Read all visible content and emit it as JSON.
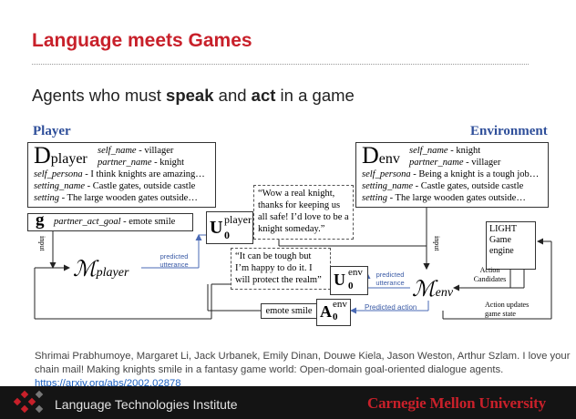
{
  "slide": {
    "title": "Language meets Games",
    "subtitle_pre": "Agents who must ",
    "subtitle_b1": "speak",
    "subtitle_mid": " and ",
    "subtitle_b2": "act",
    "subtitle_post": " in a game"
  },
  "diagram": {
    "player_header": "Player",
    "env_header": "Environment",
    "player_box": {
      "D": "D",
      "D_sub": "player",
      "l1_key": "self_name",
      "l1_val": " - villager",
      "l2_key": "partner_name",
      "l2_val": " - knight",
      "l3_key": "self_persona",
      "l3_val": " - I think knights are amazing…",
      "l4_key": "setting_name",
      "l4_val": " - Castle gates, outside castle",
      "l5_key": "setting",
      "l5_val": " - The large wooden gates outside…"
    },
    "goal_box": {
      "g": "g",
      "key": "partner_act_goal",
      "val": " - emote smile"
    },
    "env_box": {
      "D": "D",
      "D_sub": "env",
      "l1_key": "self_name",
      "l1_val": " - knight",
      "l2_key": "partner_name",
      "l2_val": " - villager",
      "l3_key": "self_persona",
      "l3_val": " - Being a knight is a tough job…",
      "l4_key": "setting_name",
      "l4_val": " - Castle gates, outside castle",
      "l5_key": "setting",
      "l5_val": " - The large wooden gates outside…"
    },
    "player_utterance": "“Wow a real knight, thanks for keeping us all safe! I’d love to be a knight someday.”",
    "env_utterance": "“It can be tough but I’m happy to do it. I will protect the realm”",
    "env_action": "emote smile",
    "U_player": "U",
    "U_player_sup": "player",
    "U_player_sub": "0",
    "U_env": "U",
    "U_env_sup": "env",
    "U_env_sub": "0",
    "A_env": "A",
    "A_env_sup": "env",
    "A_env_sub": "0",
    "M_player": "ℳ",
    "M_player_sub": "player",
    "M_env": "ℳ",
    "M_env_sub": "env",
    "input_left": "input",
    "input_right": "input",
    "predicted_utterance_left": "predicted utterance",
    "predicted_utterance_right": "predicted utterance",
    "predicted_action": "Predicted action",
    "light_engine": "LIGHT Game engine",
    "action_candidates": "Action Candidates",
    "action_updates": "Action updates game state"
  },
  "citation": {
    "text": "Shrimai Prabhumoye, Margaret Li, Jack Urbanek, Emily Dinan, Douwe Kiela, Jason Weston, Arthur Szlam. I love your chain mail! Making knights smile in a fantasy game world: Open-domain goal-oriented dialogue agents. ",
    "link": "https://arxiv.org/abs/2002.02878"
  },
  "footer": {
    "institute": "Language Technologies Institute",
    "university": "Carnegie Mellon University"
  },
  "colors": {
    "title_red": "#c8202a",
    "header_blue": "#2f4f9a",
    "footer_bg": "#141414"
  }
}
